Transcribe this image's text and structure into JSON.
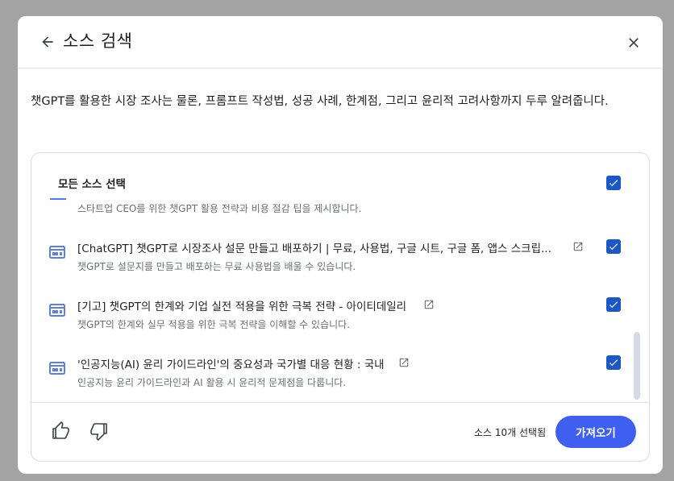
{
  "dialog": {
    "title": "소스 검색",
    "summary": "챗GPT를 활용한 시장 조사는 물론, 프롬프트 작성법, 성공 사례, 한계점, 그리고 윤리적 고려사항까지 두루 알려줍니다."
  },
  "sources": {
    "select_all_label": "모든 소스 선택",
    "first_partial_description": "스타트업 CEO를 위한 챗GPT 활용 전략과 비용 절감 팁을 제시합니다.",
    "items": [
      {
        "title": "[ChatGPT] 챗GPT로 시장조사 설문 만들고 배포하기 | 무료, 사용법, 구글 시트, 구글 폼, 앱스 스크립...",
        "description": "챗GPT로 설문지를 만들고 배포하는 무료 사용법을 배울 수 있습니다.",
        "checked": true
      },
      {
        "title": "[기고] 챗GPT의 한계와 기업 실전 적용을 위한 극복 전략 - 아이티데일리",
        "description": "챗GPT의 한계와 실무 적용을 위한 극복 전략을 이해할 수 있습니다.",
        "checked": true
      },
      {
        "title": "'인공지능(AI) 윤리 가이드라인'의 중요성과 국가별 대응 현황 : 국내",
        "description": "인공지능 윤리 가이드라인과 AI 활용 시 윤리적 문제점을 다룹니다.",
        "checked": true
      }
    ]
  },
  "footer": {
    "selected_count": "소스 10개 선택됨",
    "import_label": "가져오기"
  },
  "icons": {
    "back": "arrow-left-icon",
    "close": "close-icon",
    "source": "web-source-icon",
    "external": "open-in-new-icon",
    "like": "thumb-up-icon",
    "dislike": "thumb-down-icon",
    "check": "check-icon"
  },
  "colors": {
    "accent": "#3f5ff0",
    "checkbox": "#1a57c8",
    "source_icon": "#5b7ef0"
  }
}
